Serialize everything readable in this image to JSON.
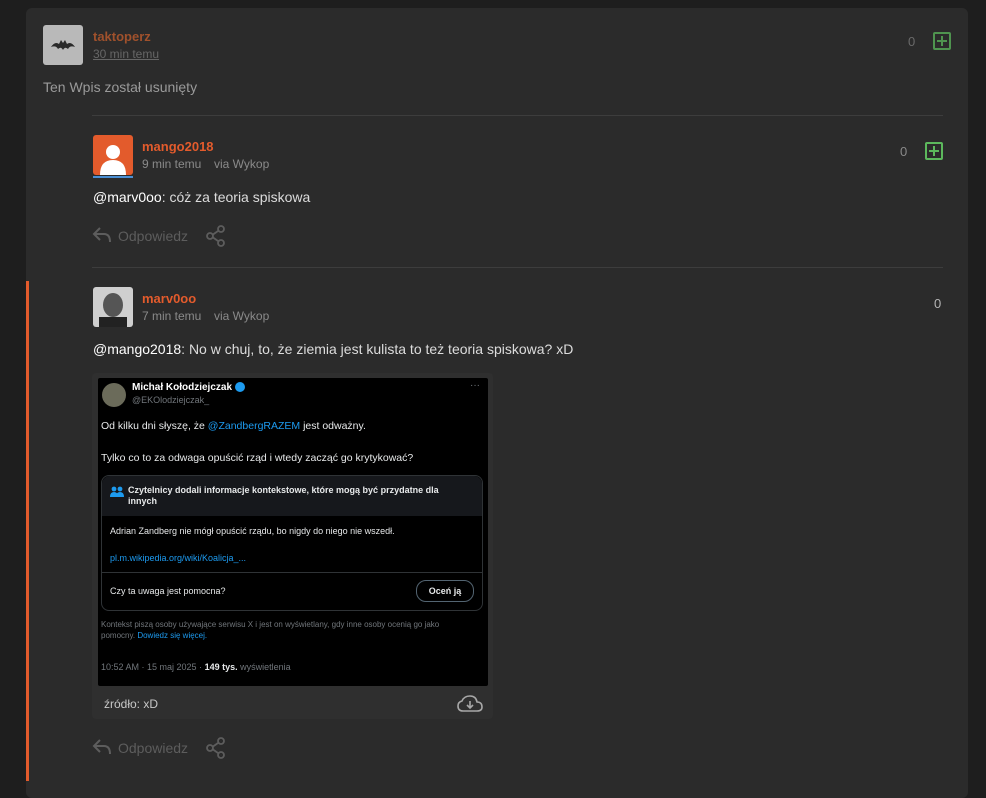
{
  "colors": {
    "accent": "#e35b2c",
    "plus": "#5cb85c"
  },
  "post1": {
    "author": "taktoperz",
    "time": "30 min temu",
    "votes": "0",
    "body": "Ten Wpis został usunięty"
  },
  "comment1": {
    "author": "mango2018",
    "time": "9 min temu",
    "via": "via Wykop",
    "votes": "0",
    "mention": "@marv0oo",
    "text": ": cóż za teoria spiskowa",
    "reply": "Odpowiedz"
  },
  "comment2": {
    "author": "marv0oo",
    "time": "7 min temu",
    "via": "via Wykop",
    "votes": "0",
    "mention": "@mango2018",
    "text": ": No w chuj, to, że ziemia jest kulista to też teoria spiskowa? xD",
    "reply": "Odpowiedz",
    "source": "źródło: xD"
  },
  "tweet": {
    "name": "Michał Kołodziejczak",
    "handle": "@EKOlodziejczak_",
    "line1_pre": "Od kilku dni słyszę, że ",
    "line1_link": "@ZandbergRAZEM",
    "line1_post": " jest odważny.",
    "line2": "Tylko co to za odwaga opuścić rząd i wtedy zacząć go krytykować?",
    "note_title": "Czytelnicy dodali informacje kontekstowe, które mogą być przydatne dla innych",
    "note_text": "Adrian Zandberg nie mógł opuścić rządu, bo nigdy do niego nie wszedł.",
    "note_link": "pl.m.wikipedia.org/wiki/Koalicja_...",
    "helpful_q": "Czy ta uwaga jest pomocna?",
    "rate": "Oceń ją",
    "context1": "Kontekst piszą osoby używające serwisu X i jest on wyświetlany, gdy inne osoby ocenią go jako",
    "context2_pre": "pomocny. ",
    "context2_link": "Dowiedz się więcej.",
    "date": "10:52 AM · 15 maj 2025 · ",
    "views_num": "149 tys.",
    "views_label": " wyświetlenia"
  }
}
